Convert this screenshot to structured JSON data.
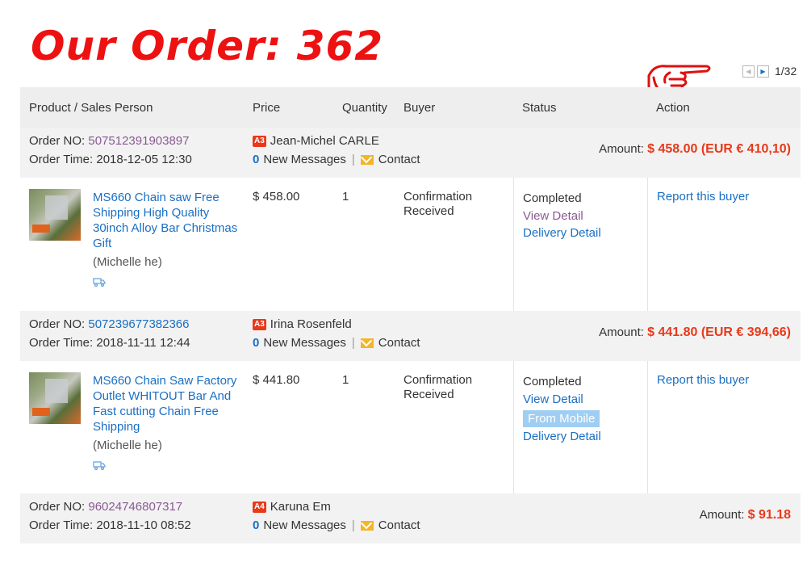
{
  "banner": {
    "title": "Our Order:",
    "number": "362"
  },
  "pager": {
    "text": "1/32"
  },
  "headers": {
    "product": "Product / Sales Person",
    "price": "Price",
    "quantity": "Quantity",
    "buyer": "Buyer",
    "status": "Status",
    "action": "Action"
  },
  "orders": [
    {
      "no_label": "Order NO:",
      "no": "507512391903897",
      "time_label": "Order Time:",
      "time": "2018-12-05 12:30",
      "buyer_level": "A3",
      "buyer": "Jean-Michel CARLE",
      "msg_count": "0",
      "msg_label": "New Messages",
      "sep": "|",
      "contact": "Contact",
      "amount_label": "Amount:",
      "amount": "$ 458.00 (EUR € 410,10)",
      "item": {
        "title": "MS660 Chain saw Free Shipping High Quality 30inch Alloy Bar Christmas Gift",
        "seller": "(Michelle he)",
        "price": "$ 458.00",
        "qty": "1",
        "buyer_status": "Confirmation Received",
        "status": "Completed",
        "view": "View Detail",
        "delivery": "Delivery Detail",
        "action": "Report this buyer"
      }
    },
    {
      "no_label": "Order NO:",
      "no": "507239677382366",
      "time_label": "Order Time:",
      "time": "2018-11-11 12:44",
      "buyer_level": "A3",
      "buyer": "Irina Rosenfeld",
      "msg_count": "0",
      "msg_label": "New Messages",
      "sep": "|",
      "contact": "Contact",
      "amount_label": "Amount:",
      "amount": "$ 441.80 (EUR € 394,66)",
      "item": {
        "title": "MS660 Chain Saw Factory Outlet WHITOUT Bar And Fast cutting Chain Free Shipping",
        "seller": "(Michelle he)",
        "price": "$ 441.80",
        "qty": "1",
        "buyer_status": "Confirmation Received",
        "status": "Completed",
        "view": "View Detail",
        "mobile": "From Mobile",
        "delivery": "Delivery Detail",
        "action": "Report this buyer"
      }
    },
    {
      "no_label": "Order NO:",
      "no": "96024746807317",
      "time_label": "Order Time:",
      "time": "2018-11-10 08:52",
      "buyer_level": "A4",
      "buyer": "Karuna Em",
      "msg_count": "0",
      "msg_label": "New Messages",
      "sep": "|",
      "contact": "Contact",
      "amount_label": "Amount:",
      "amount": "$ 91.18"
    }
  ]
}
